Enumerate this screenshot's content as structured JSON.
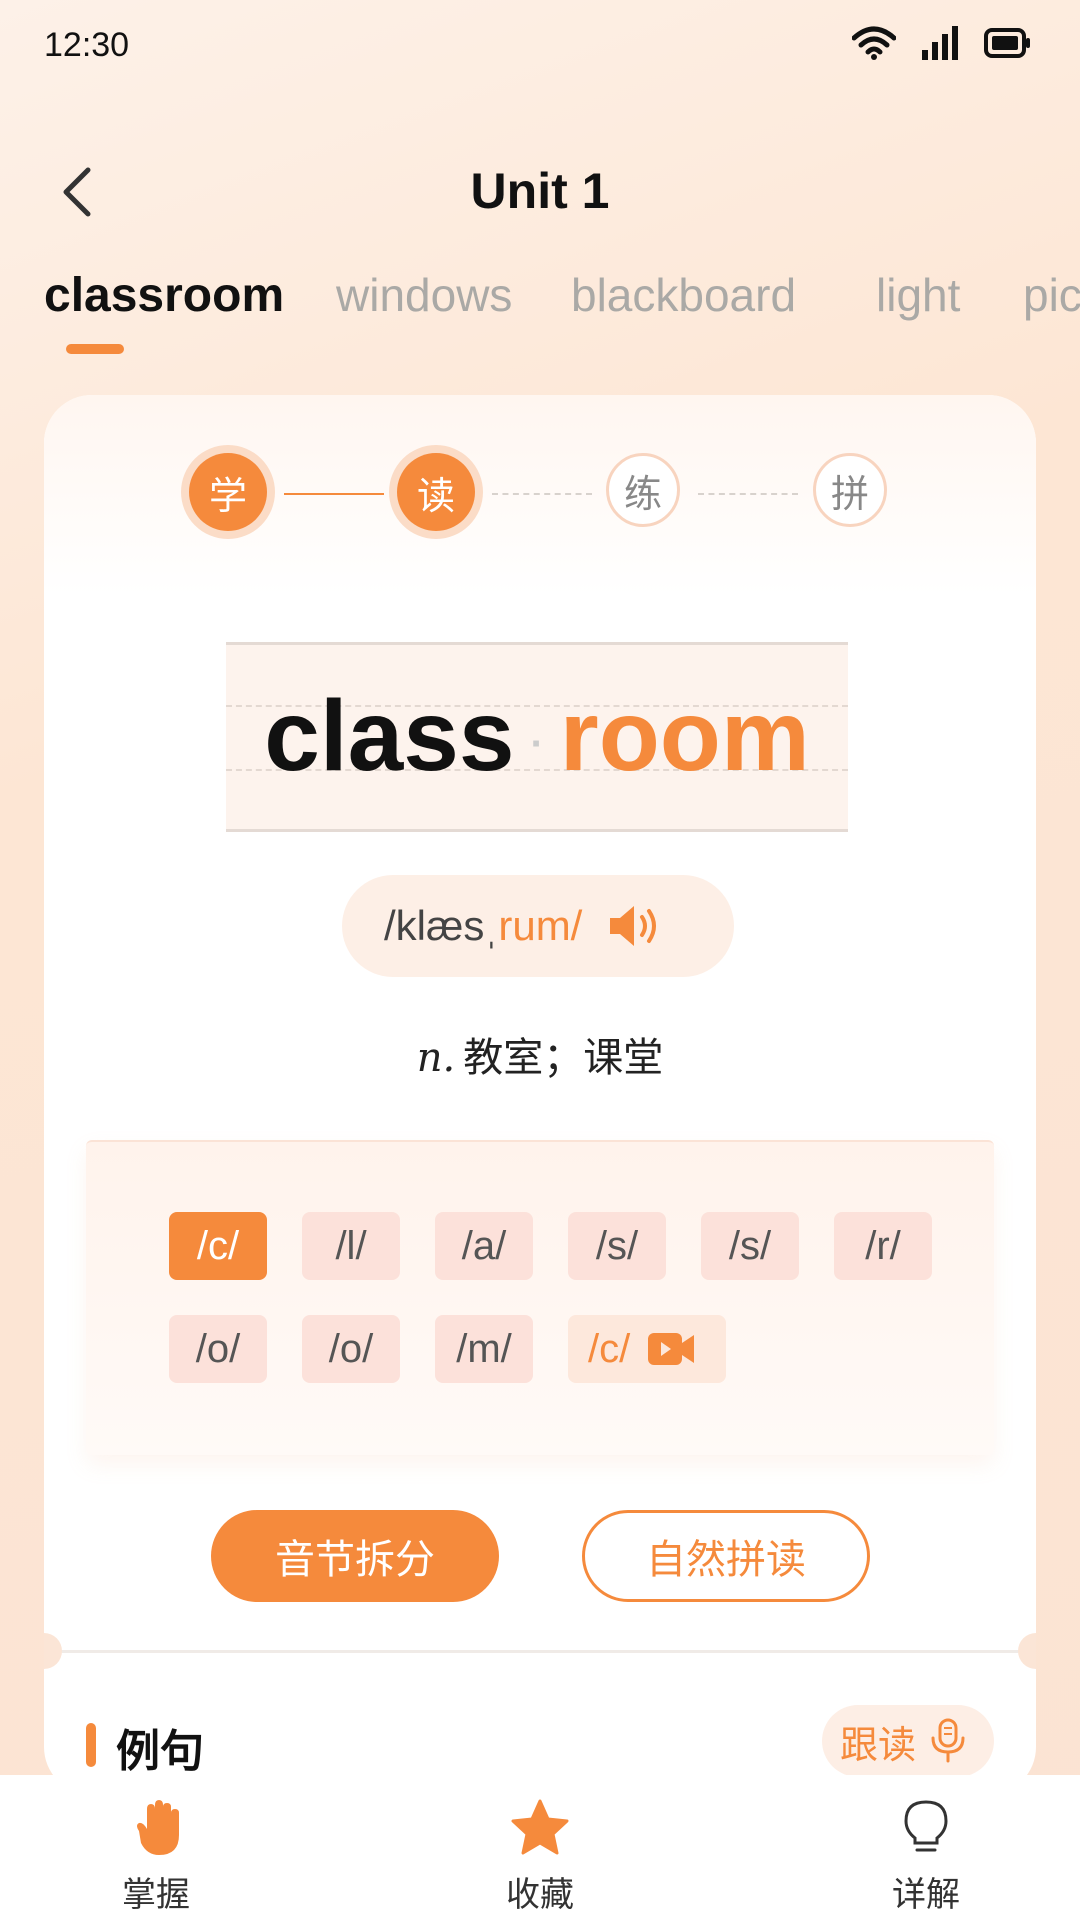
{
  "status_bar": {
    "time": "12:30",
    "icons": [
      "wifi-icon",
      "signal-icon",
      "battery-icon"
    ]
  },
  "header": {
    "title": "Unit 1",
    "back_icon": "chevron-left-icon"
  },
  "tabs": [
    {
      "label": "classroom",
      "active": true
    },
    {
      "label": "windows",
      "active": false
    },
    {
      "label": "blackboard",
      "active": false
    },
    {
      "label": "light",
      "active": false
    },
    {
      "label": "pic",
      "active": false
    }
  ],
  "steps": [
    {
      "label": "学",
      "done": true
    },
    {
      "label": "读",
      "done": true
    },
    {
      "label": "练",
      "done": false
    },
    {
      "label": "拼",
      "done": false
    }
  ],
  "word": {
    "syllable_1": "class",
    "separator": "·",
    "syllable_2": "room"
  },
  "phonetic": {
    "part_1": "/klæsˌ",
    "part_2": "rum/",
    "icon": "speaker-icon"
  },
  "meaning": {
    "pos": "n.",
    "text": "教室；课堂"
  },
  "phonemes": [
    {
      "label": "/c/",
      "active": true
    },
    {
      "label": "/l/",
      "active": false
    },
    {
      "label": "/a/",
      "active": false
    },
    {
      "label": "/s/",
      "active": false
    },
    {
      "label": "/s/",
      "active": false
    },
    {
      "label": "/r/",
      "active": false
    },
    {
      "label": "/o/",
      "active": false
    },
    {
      "label": "/o/",
      "active": false
    },
    {
      "label": "/m/",
      "active": false
    },
    {
      "label": "/c/",
      "active": false,
      "icon": "video-icon"
    }
  ],
  "buttons": {
    "syllable_split": "音节拆分",
    "natural_phonics": "自然拼读"
  },
  "example_section": {
    "title": "例句",
    "follow_read": "跟读",
    "follow_icon": "microphone-icon"
  },
  "bottom_nav": [
    {
      "label": "掌握",
      "icon": "hand-icon"
    },
    {
      "label": "收藏",
      "icon": "star-icon"
    },
    {
      "label": "详解",
      "icon": "lightbulb-icon"
    }
  ],
  "colors": {
    "accent": "#f58a3c",
    "chip_bg": "#fce1da",
    "background": "#fde6d4"
  }
}
